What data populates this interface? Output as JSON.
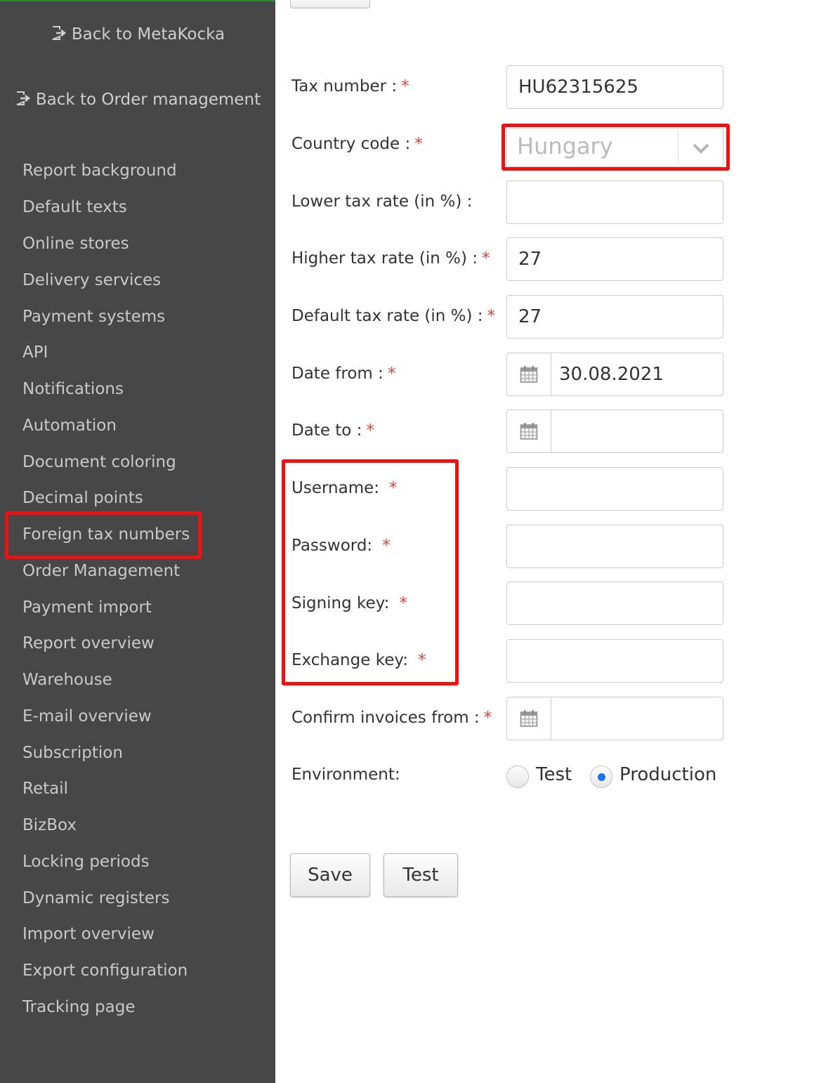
{
  "sidebar": {
    "back_metakocka": "Back to MetaKocka",
    "back_order_management": "Back to Order management",
    "items": [
      {
        "label": "Report background"
      },
      {
        "label": "Default texts"
      },
      {
        "label": "Online stores"
      },
      {
        "label": "Delivery services"
      },
      {
        "label": "Payment systems"
      },
      {
        "label": "API"
      },
      {
        "label": "Notifications"
      },
      {
        "label": "Automation"
      },
      {
        "label": "Document coloring"
      },
      {
        "label": "Decimal points"
      },
      {
        "label": "Foreign tax numbers"
      },
      {
        "label": "Order Management"
      },
      {
        "label": "Payment import"
      },
      {
        "label": "Report overview"
      },
      {
        "label": "Warehouse"
      },
      {
        "label": "E-mail overview"
      },
      {
        "label": "Subscription"
      },
      {
        "label": "Retail"
      },
      {
        "label": "BizBox"
      },
      {
        "label": "Locking periods"
      },
      {
        "label": "Dynamic registers"
      },
      {
        "label": "Import overview"
      },
      {
        "label": "Export configuration"
      },
      {
        "label": "Tracking page"
      }
    ]
  },
  "form": {
    "tax_number": {
      "label": "Tax number :",
      "required": "*",
      "value": "HU62315625"
    },
    "country_code": {
      "label": "Country code :",
      "required": "*",
      "value": "Hungary"
    },
    "lower_tax_rate": {
      "label": "Lower tax rate (in %) :",
      "value": ""
    },
    "higher_tax_rate": {
      "label": "Higher tax rate (in %) :",
      "required": "*",
      "value": "27"
    },
    "default_tax_rate": {
      "label": "Default tax rate (in %) :",
      "required": "*",
      "value": "27"
    },
    "date_from": {
      "label": "Date from :",
      "required": "*",
      "value": "30.08.2021"
    },
    "date_to": {
      "label": "Date to :",
      "required": "*",
      "value": ""
    },
    "username": {
      "label": "Username:",
      "required": "*",
      "value": ""
    },
    "password": {
      "label": "Password:",
      "required": "*",
      "value": ""
    },
    "signing_key": {
      "label": "Signing key:",
      "required": "*",
      "value": ""
    },
    "exchange_key": {
      "label": "Exchange key:",
      "required": "*",
      "value": ""
    },
    "confirm_invoices_from": {
      "label": "Confirm invoices from :",
      "required": "*",
      "value": ""
    },
    "environment": {
      "label": "Environment:",
      "options": [
        {
          "label": "Test",
          "selected": false
        },
        {
          "label": "Production",
          "selected": true
        }
      ]
    }
  },
  "buttons": {
    "save": "Save",
    "test": "Test"
  },
  "icons": {
    "back": "sign-out-icon",
    "calendar": "calendar-icon",
    "chevron": "chevron-down-icon"
  },
  "colors": {
    "sidebar_bg": "#474747",
    "highlight": "#ee1111",
    "required": "#e0413a",
    "radio_selected": "#1a73e8"
  }
}
